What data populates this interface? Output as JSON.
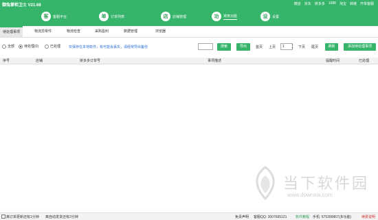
{
  "app": {
    "title": "御兔掌柜卫士 V21.68"
  },
  "top_links": [
    "微店",
    "京东",
    "拼多多",
    "1688",
    "淘宝",
    "转链",
    "开单客服"
  ],
  "nav": [
    {
      "icon": "客",
      "label": "客服平台"
    },
    {
      "icon": "单",
      "label": "订单列表"
    },
    {
      "icon": "店",
      "label": "店铺管理"
    },
    {
      "icon": "功",
      "label": "常用功能"
    },
    {
      "icon": "设",
      "label": "设置"
    }
  ],
  "tabs": [
    "待处理事项",
    "物流异常件",
    "物流检查",
    "采购盈利",
    "数据管理",
    "浏览器"
  ],
  "filters": {
    "options": [
      "全部",
      "待处理(0)",
      "已处理"
    ],
    "tip": "仅保存在本地软件，有可能会丢失，请经常导出备份",
    "search_label": "搜索",
    "export_label": "导出",
    "first_label": "首页",
    "prev_label": "上页",
    "page_value": "1",
    "next_label": "下页",
    "last_label": "尾页",
    "refresh_label": "刷新",
    "add_label": "添加待处理事项"
  },
  "table": {
    "columns": [
      "序号",
      "店铺",
      "拼多多订单号",
      "事项描述",
      "提醒时间",
      "已处理"
    ]
  },
  "status": {
    "left1": "离订单更新还有1分钟",
    "left2": "离自动发货还有2分钟",
    "disclaimer": "免责声明",
    "qq_label": "客服QQ: 3007665121",
    "tutorial": "软件教程",
    "phone": "手机: 575399867(多功能)",
    "contact": "续费说明"
  },
  "watermark": {
    "text": "当下软件园",
    "url": "www.downxia.com"
  },
  "colors": {
    "brand": "#35b46a",
    "link": "#2a6fd6",
    "alert": "#d0302d"
  }
}
